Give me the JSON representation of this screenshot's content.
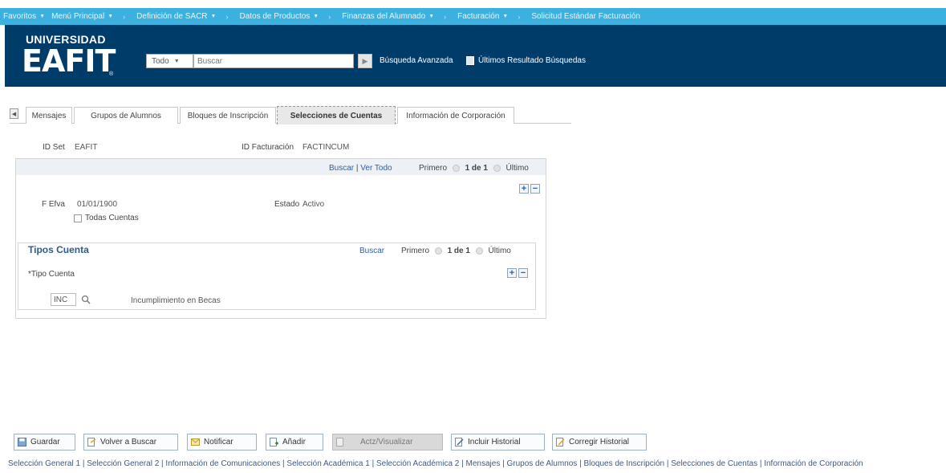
{
  "topnav": {
    "items": [
      {
        "label": "Favoritos",
        "caret": true,
        "sep": false
      },
      {
        "label": "Menú Principal",
        "caret": true,
        "sep": true
      },
      {
        "label": "Definición de SACR",
        "caret": true,
        "sep": true
      },
      {
        "label": "Datos de Productos",
        "caret": true,
        "sep": true
      },
      {
        "label": "Finanzas del Alumnado",
        "caret": true,
        "sep": true
      },
      {
        "label": "Facturación",
        "caret": true,
        "sep": true
      },
      {
        "label": "Solicitud Estándar Facturación",
        "caret": false,
        "sep": false
      }
    ]
  },
  "header": {
    "logo_small": "UNIVERSIDAD",
    "logo_big": "EAFIT",
    "logo_reg": "®",
    "search_scope": "Todo",
    "search_placeholder": "Buscar",
    "advanced_search": "Búsqueda Avanzada",
    "last_results": "Últimos Resultado Búsquedas"
  },
  "tabs": [
    {
      "label": "Mensajes",
      "active": false
    },
    {
      "label": "Grupos de Alumnos",
      "active": false
    },
    {
      "label": "Bloques de Inscripción",
      "active": false
    },
    {
      "label": "Selecciones de Cuentas",
      "active": true
    },
    {
      "label": "Información de Corporación",
      "active": false
    }
  ],
  "form": {
    "setid_label": "ID Set",
    "setid_value": "EAFIT",
    "billing_id_label": "ID Facturación",
    "billing_id_value": "FACTINCUM",
    "effdt_label": "F Efva",
    "effdt_value": "01/01/1900",
    "status_label": "Estado",
    "status_value": "Activo",
    "all_accounts_label": "Todas Cuentas"
  },
  "pager_outer": {
    "find": "Buscar",
    "view_all": "Ver Todo",
    "first": "Primero",
    "count": "1 de 1",
    "last": "Último"
  },
  "inner": {
    "title": "Tipos Cuenta",
    "find": "Buscar",
    "first": "Primero",
    "count": "1 de 1",
    "last": "Último",
    "type_label": "*Tipo Cuenta",
    "type_code": "INC",
    "type_description": "Incumplimiento en Becas"
  },
  "toolbar": {
    "save": "Guardar",
    "return_search": "Volver a Buscar",
    "notify": "Notificar",
    "add": "Añadir",
    "update_display": "Actz/Visualizar",
    "include_history": "Incluir Historial",
    "correct_history": "Corregir Historial"
  },
  "bottom_links": "Selección General 1 | Selección General 2 | Información de Comunicaciones | Selección Académica 1 | Selección Académica 2 | Mensajes | Grupos de Alumnos | Bloques de Inscripción | Selecciones de Cuentas | Información de Corporación",
  "colors": {
    "topnav": "#3cb0df",
    "header": "#003c6a",
    "link": "#2b5ea8"
  }
}
